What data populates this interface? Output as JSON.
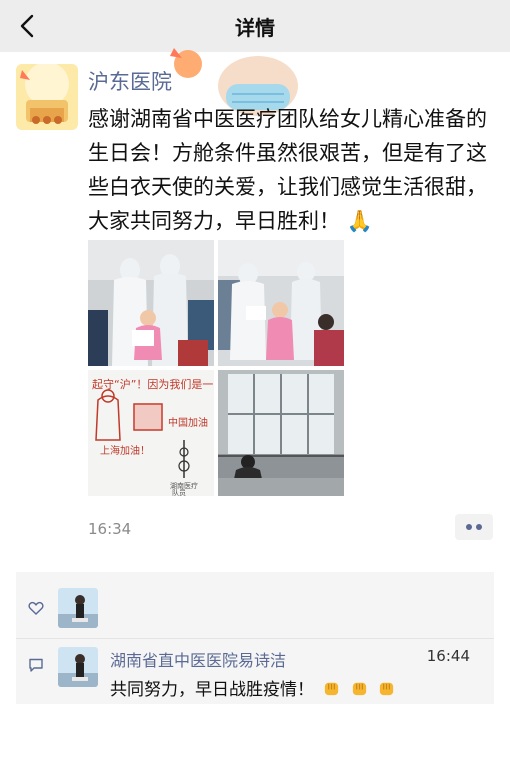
{
  "nav": {
    "title": "详情",
    "back_icon": "chevron-left-icon"
  },
  "post": {
    "author": "沪东医院",
    "text": "感谢湖南省中医医疗团队给女儿精心准备的生日会！方舱条件虽然很艰苦，但是有了这些白衣天使的关爱，让我们感觉生活很甜，大家共同努力，早日胜利！",
    "text_emoji": "🙏",
    "time": "16:34",
    "images": [
      {
        "kind": "photo",
        "subject": "medical staff in protective suits with a girl in pink holding a card"
      },
      {
        "kind": "photo",
        "subject": "medical staff and a girl in pink in a ward"
      },
      {
        "kind": "drawing",
        "lines": [
          "起守“沪”！因为我们是一家",
          "上海加油！",
          "中国加油",
          "湖南医疗",
          "队员"
        ]
      },
      {
        "kind": "photo",
        "subject": "patient sitting on bed by a large window"
      }
    ]
  },
  "likes": {
    "icon": "heart-icon"
  },
  "comment": {
    "icon": "comment-icon",
    "name": "湖南省直中医医院易诗洁",
    "time": "16:44",
    "text": "共同努力，早日战胜疫情！",
    "emojis": [
      "fist-emoji",
      "fist-emoji",
      "fist-emoji"
    ]
  },
  "colors": {
    "link": "#5a6a94",
    "nav_bg": "#ededed",
    "panel_bg": "#f5f5f5"
  }
}
